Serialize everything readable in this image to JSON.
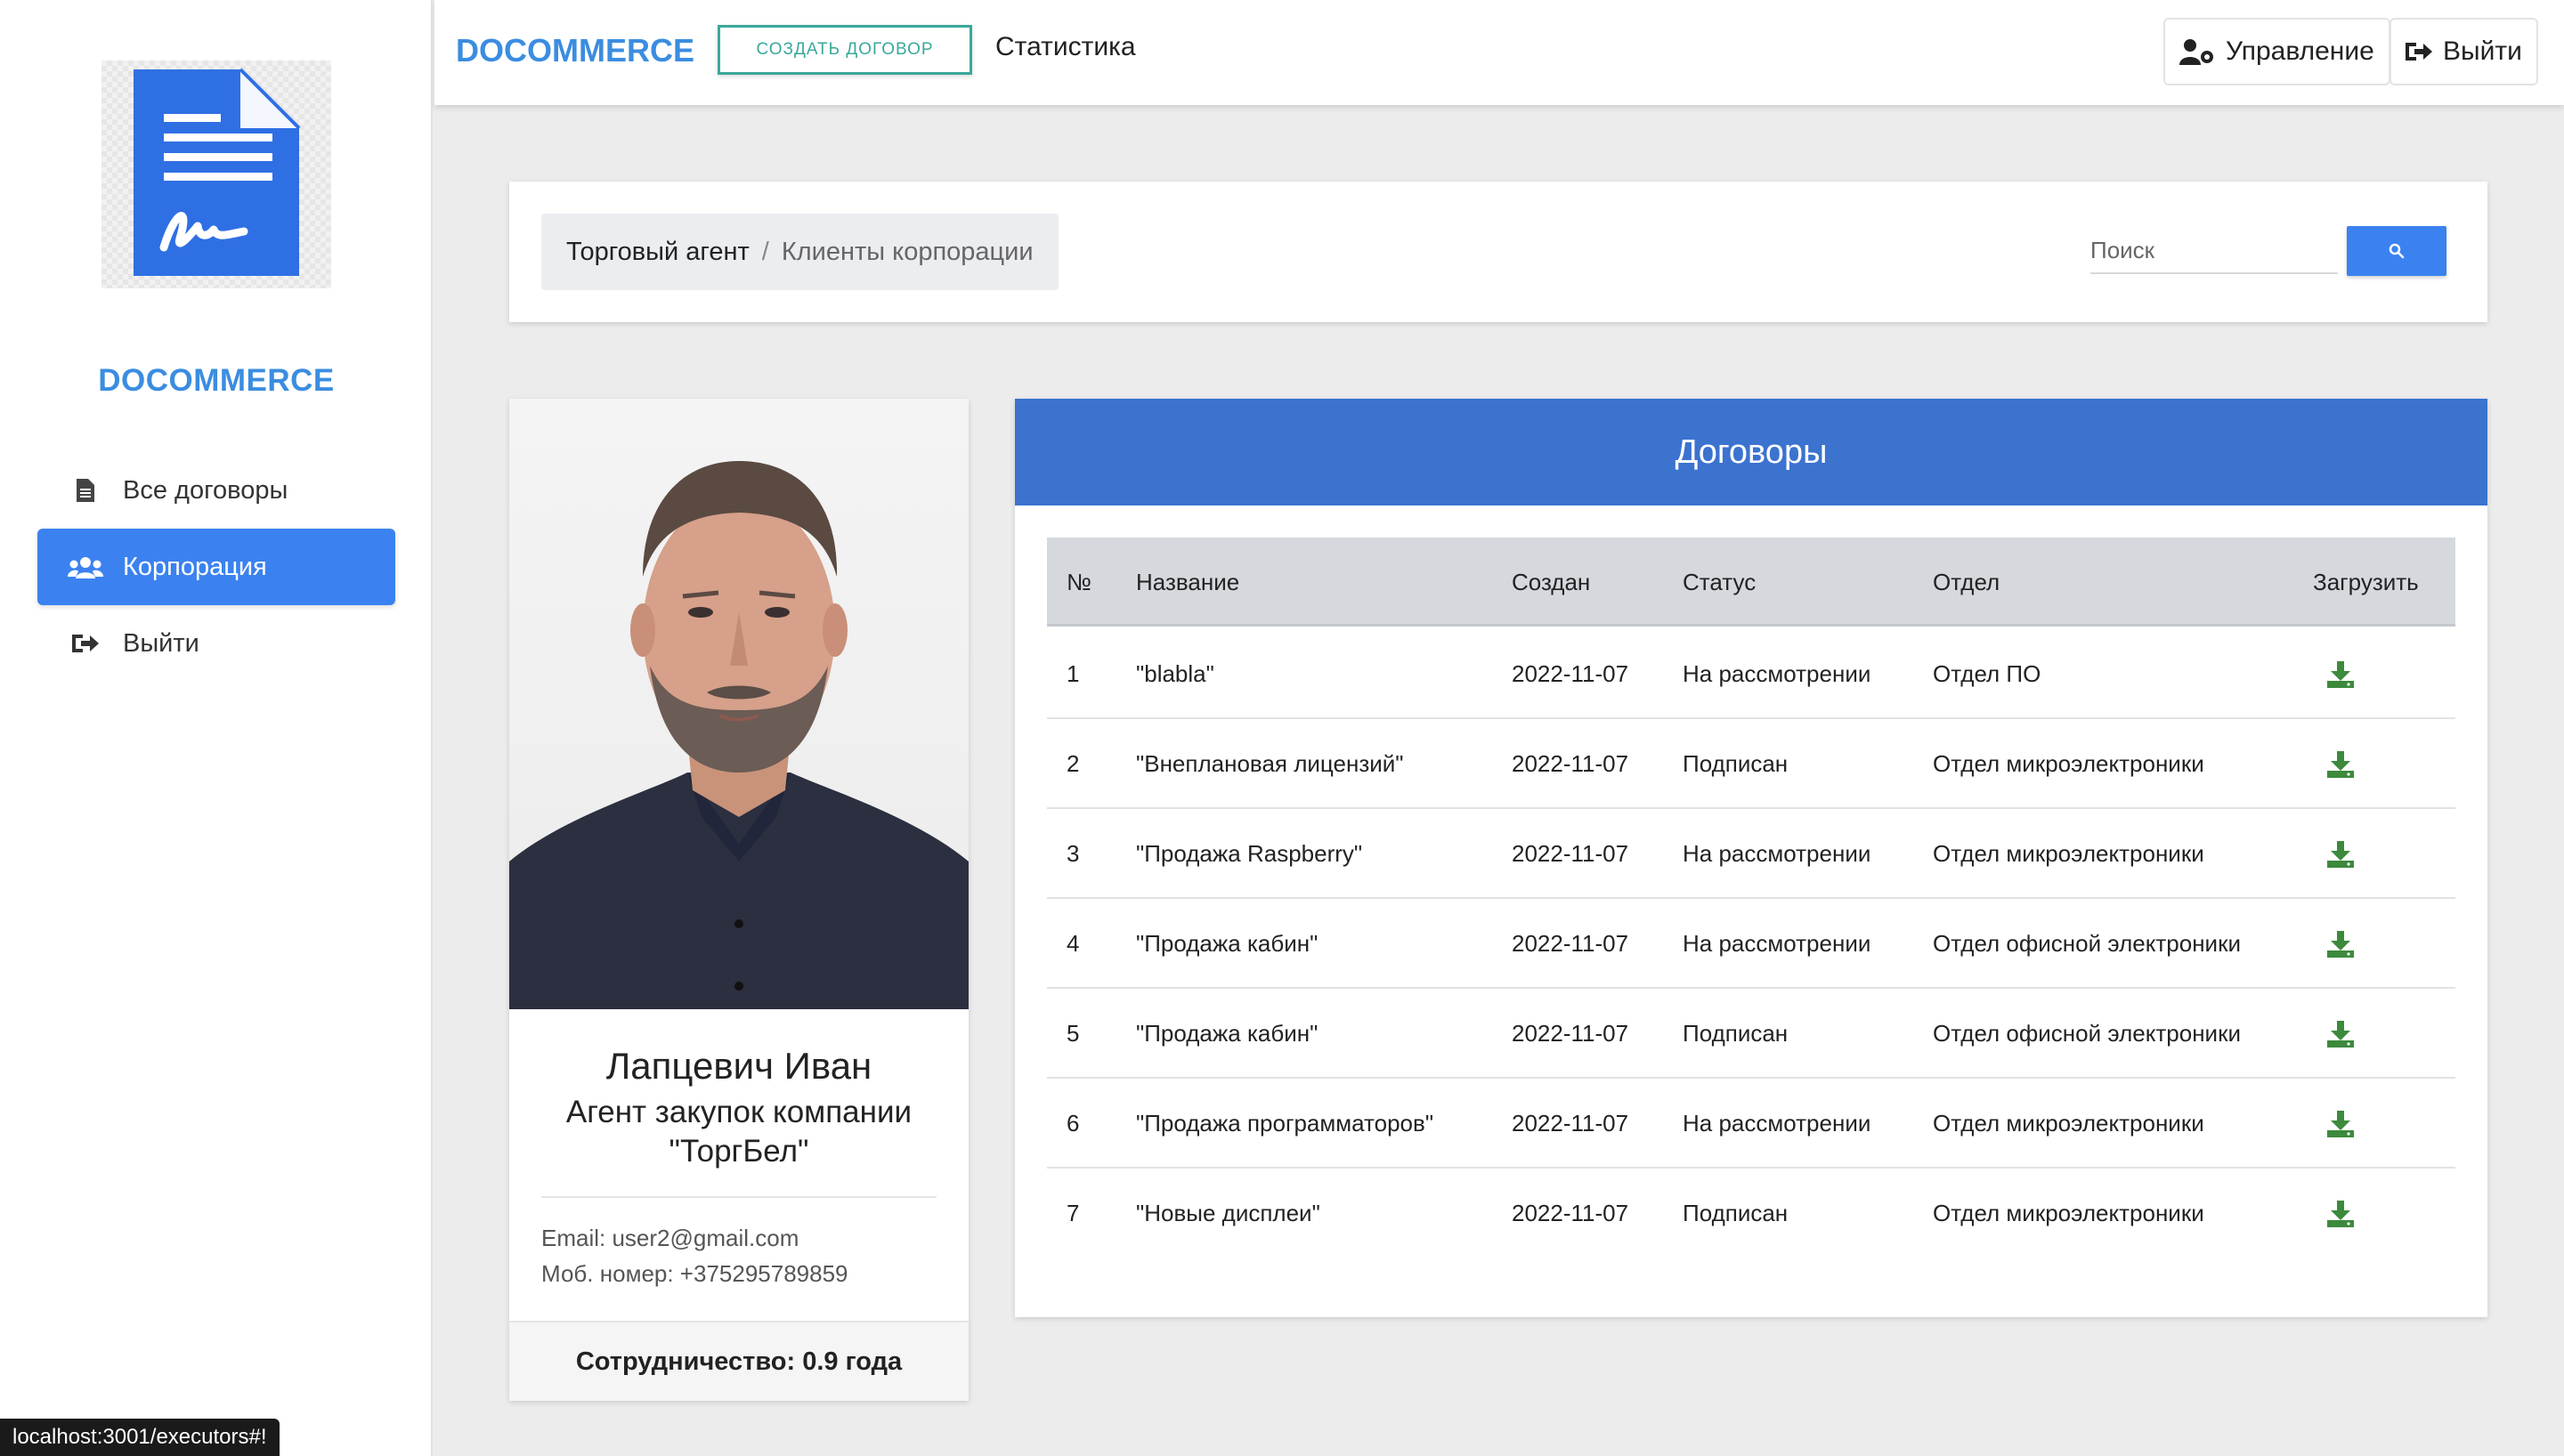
{
  "sidebar": {
    "brand": "DOCOMMERCE",
    "items": [
      {
        "label": "Все договоры",
        "icon": "file-icon",
        "active": false
      },
      {
        "label": "Корпорация",
        "icon": "users-icon",
        "active": true
      },
      {
        "label": "Выйти",
        "icon": "sign-out-icon",
        "active": false
      }
    ]
  },
  "topbar": {
    "brand": "DOCOMMERCE",
    "create_button": "СОЗДАТЬ ДОГОВОР",
    "stats_link": "Статистика",
    "manage_button": "Управление",
    "logout_button": "Выйти"
  },
  "breadcrumb": {
    "item1": "Торговый агент",
    "separator": "/",
    "item2": "Клиенты корпорации"
  },
  "search": {
    "placeholder": "Поиск"
  },
  "profile": {
    "name": "Лапцевич Иван",
    "role": "Агент закупок компании \"ТоргБел\"",
    "email": "Email: user2@gmail.com",
    "phone": "Моб. номер: +375295789859",
    "cooperation": "Сотрудничество: 0.9 года"
  },
  "contracts": {
    "title": "Договоры",
    "columns": [
      "№",
      "Название",
      "Создан",
      "Статус",
      "Отдел",
      "Загрузить"
    ],
    "rows": [
      {
        "n": "1",
        "name": "\"blabla\"",
        "created": "2022-11-07",
        "status": "На рассмотрении",
        "dept": "Отдел ПО"
      },
      {
        "n": "2",
        "name": "\"Внеплановая лицензий\"",
        "created": "2022-11-07",
        "status": "Подписан",
        "dept": "Отдел микроэлектроники"
      },
      {
        "n": "3",
        "name": "\"Продажа Raspberry\"",
        "created": "2022-11-07",
        "status": "На рассмотрении",
        "dept": "Отдел микроэлектроники"
      },
      {
        "n": "4",
        "name": "\"Продажа кабин\"",
        "created": "2022-11-07",
        "status": "На рассмотрении",
        "dept": "Отдел офисной электроники"
      },
      {
        "n": "5",
        "name": "\"Продажа кабин\"",
        "created": "2022-11-07",
        "status": "Подписан",
        "dept": "Отдел офисной электроники"
      },
      {
        "n": "6",
        "name": "\"Продажа программаторов\"",
        "created": "2022-11-07",
        "status": "На рассмотрении",
        "dept": "Отдел микроэлектроники"
      },
      {
        "n": "7",
        "name": "\"Новые дисплеи\"",
        "created": "2022-11-07",
        "status": "Подписан",
        "dept": "Отдел микроэлектроники"
      }
    ]
  },
  "statusbar": {
    "url": "localhost:3001/executors#!"
  },
  "colors": {
    "brand": "#3b8de0",
    "accent": "#3b82f0",
    "header": "#3b73cf",
    "teal": "#3aa89a",
    "download": "#3c8a3c"
  }
}
